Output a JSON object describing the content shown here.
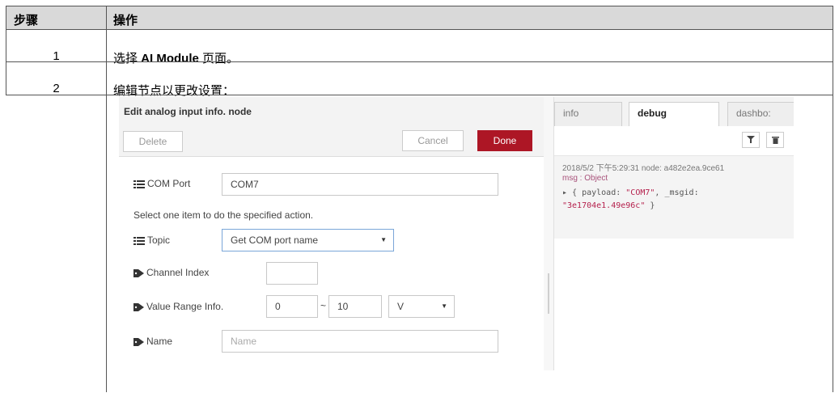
{
  "table": {
    "header": {
      "step": "步骤",
      "action": "操作"
    },
    "rows": [
      {
        "step": "1",
        "action_prefix": "选择 ",
        "action_bold": "AI Module",
        "action_suffix": " 页面。"
      },
      {
        "step": "2",
        "action": "编辑节点以更改设置："
      }
    ]
  },
  "editor": {
    "title": "Edit analog input info. node",
    "delete_label": "Delete",
    "cancel_label": "Cancel",
    "done_label": "Done",
    "com_port": {
      "label": "COM Port",
      "value": "COM7"
    },
    "hint": "Select one item to do the specified action.",
    "topic": {
      "label": "Topic",
      "value": "Get COM port name"
    },
    "channel_index": {
      "label": "Channel Index",
      "value": ""
    },
    "value_range": {
      "label": "Value Range Info.",
      "min": "0",
      "separator": "~",
      "max": "10",
      "unit": "V"
    },
    "name": {
      "label": "Name",
      "placeholder": "Name"
    }
  },
  "sidebar": {
    "tabs": [
      {
        "label": "info"
      },
      {
        "label": "debug"
      },
      {
        "label": "dashbo:"
      }
    ],
    "message": {
      "meta": "2018/5/2 下午5:29:31   node: a482e2ea.9ce61",
      "type": "msg : Object",
      "line1_prefix": "▸ { payload: ",
      "line1_value": "\"COM7\"",
      "line1_suffix": ", _msgid:",
      "line2_value": "\"3e1704e1.49e96c\"",
      "line2_suffix": " }"
    }
  },
  "colors": {
    "header_bg": "#d9d9d9",
    "done_button": "#ad1625",
    "border": "#555555"
  },
  "icons": {
    "list": "list-icon",
    "tag": "tag-icon",
    "filter": "filter-icon",
    "trash": "trash-icon",
    "caret": "caret-down-icon"
  }
}
